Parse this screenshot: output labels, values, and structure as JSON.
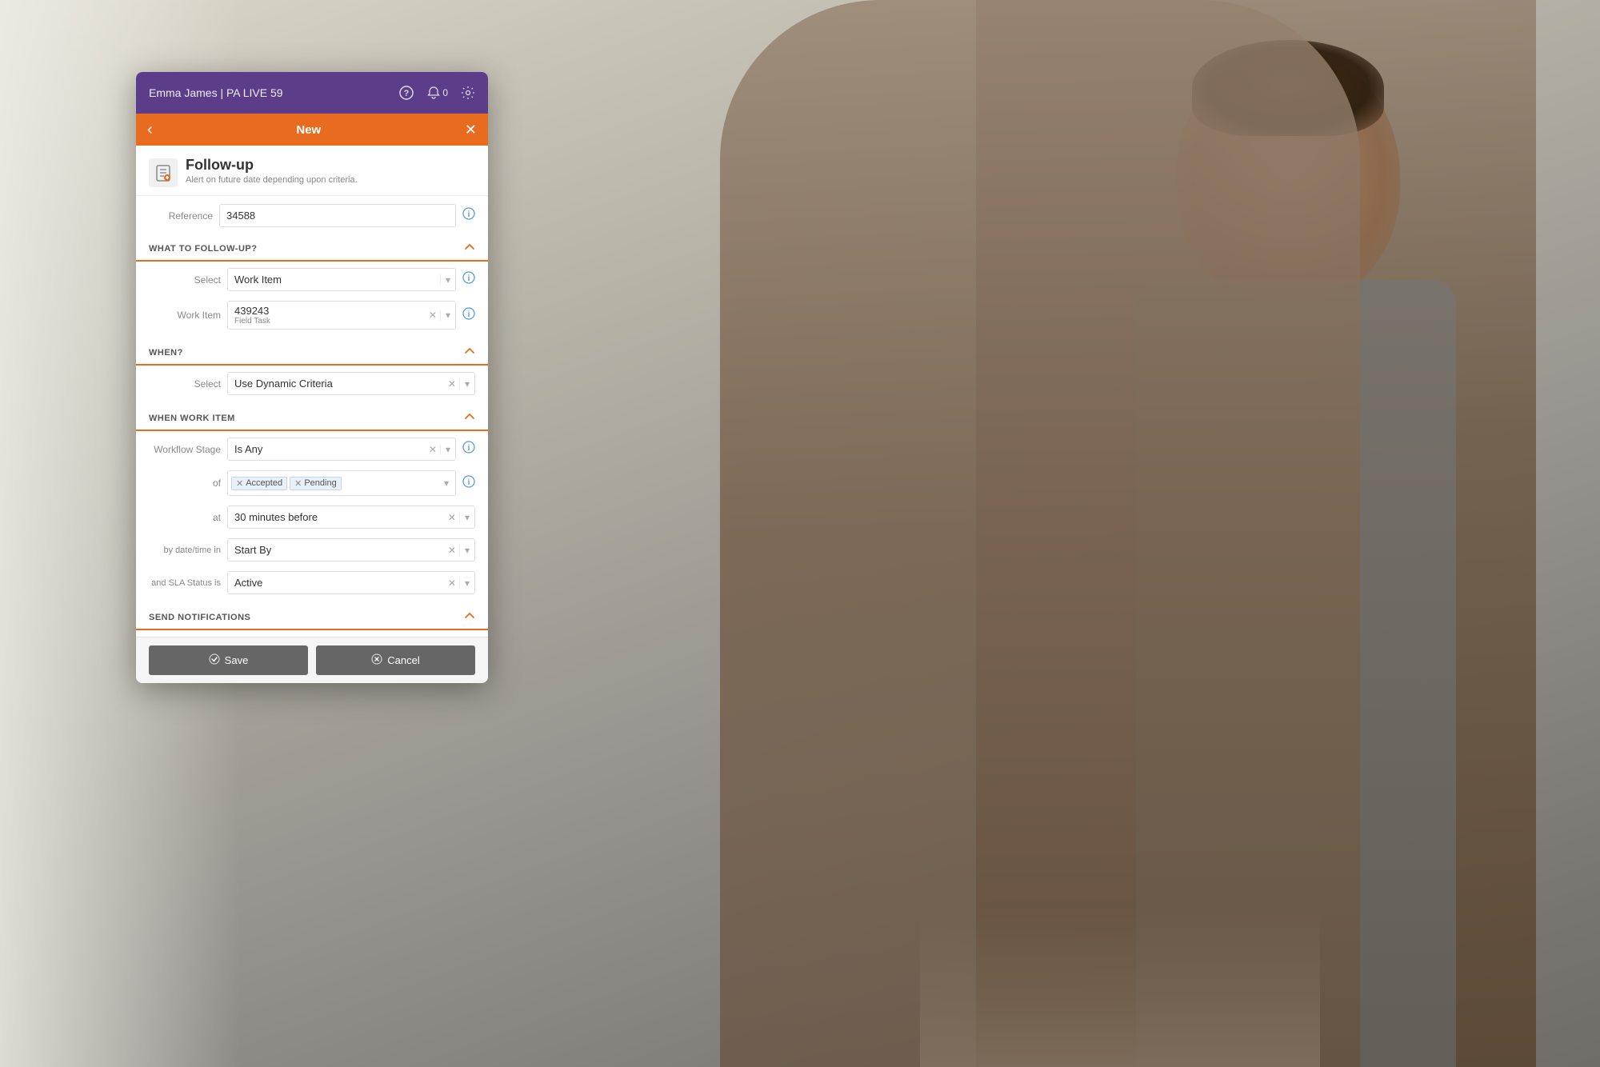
{
  "background": {
    "alt": "Man working at laptop"
  },
  "header": {
    "user_label": "Emma James | PA LIVE 59",
    "help_icon": "?",
    "bell_icon": "🔔",
    "bell_count": "0",
    "gear_icon": "⚙"
  },
  "subheader": {
    "back_icon": "‹",
    "title": "New",
    "close_icon": "✕"
  },
  "form": {
    "icon": "📋",
    "title": "Follow-up",
    "subtitle": "Alert on future date depending upon criteria.",
    "reference_label": "Reference",
    "reference_value": "34588",
    "sections": {
      "what": {
        "title": "WHAT TO FOLLOW-UP?",
        "select_label": "Select",
        "select_value": "Work Item",
        "work_item_label": "Work Item",
        "work_item_id": "439243",
        "work_item_type": "Field Task"
      },
      "when": {
        "title": "WHEN?",
        "select_label": "Select",
        "select_value": "Use Dynamic Criteria"
      },
      "when_work_item": {
        "title": "WHEN WORK ITEM",
        "workflow_stage_label": "Workflow Stage",
        "workflow_stage_value": "Is Any",
        "of_label": "of",
        "of_tags": [
          "Accepted",
          "Pending"
        ],
        "at_label": "at",
        "at_value": "30 minutes before",
        "by_datetime_label": "by date/time in",
        "by_datetime_value": "Start By",
        "sla_status_label": "and SLA Status is",
        "sla_status_value": "Active"
      },
      "send_notifications": {
        "title": "SEND NOTIFICATIONS"
      }
    }
  },
  "footer": {
    "save_label": "Save",
    "cancel_label": "Cancel",
    "save_icon": "✓",
    "cancel_icon": "✕"
  }
}
